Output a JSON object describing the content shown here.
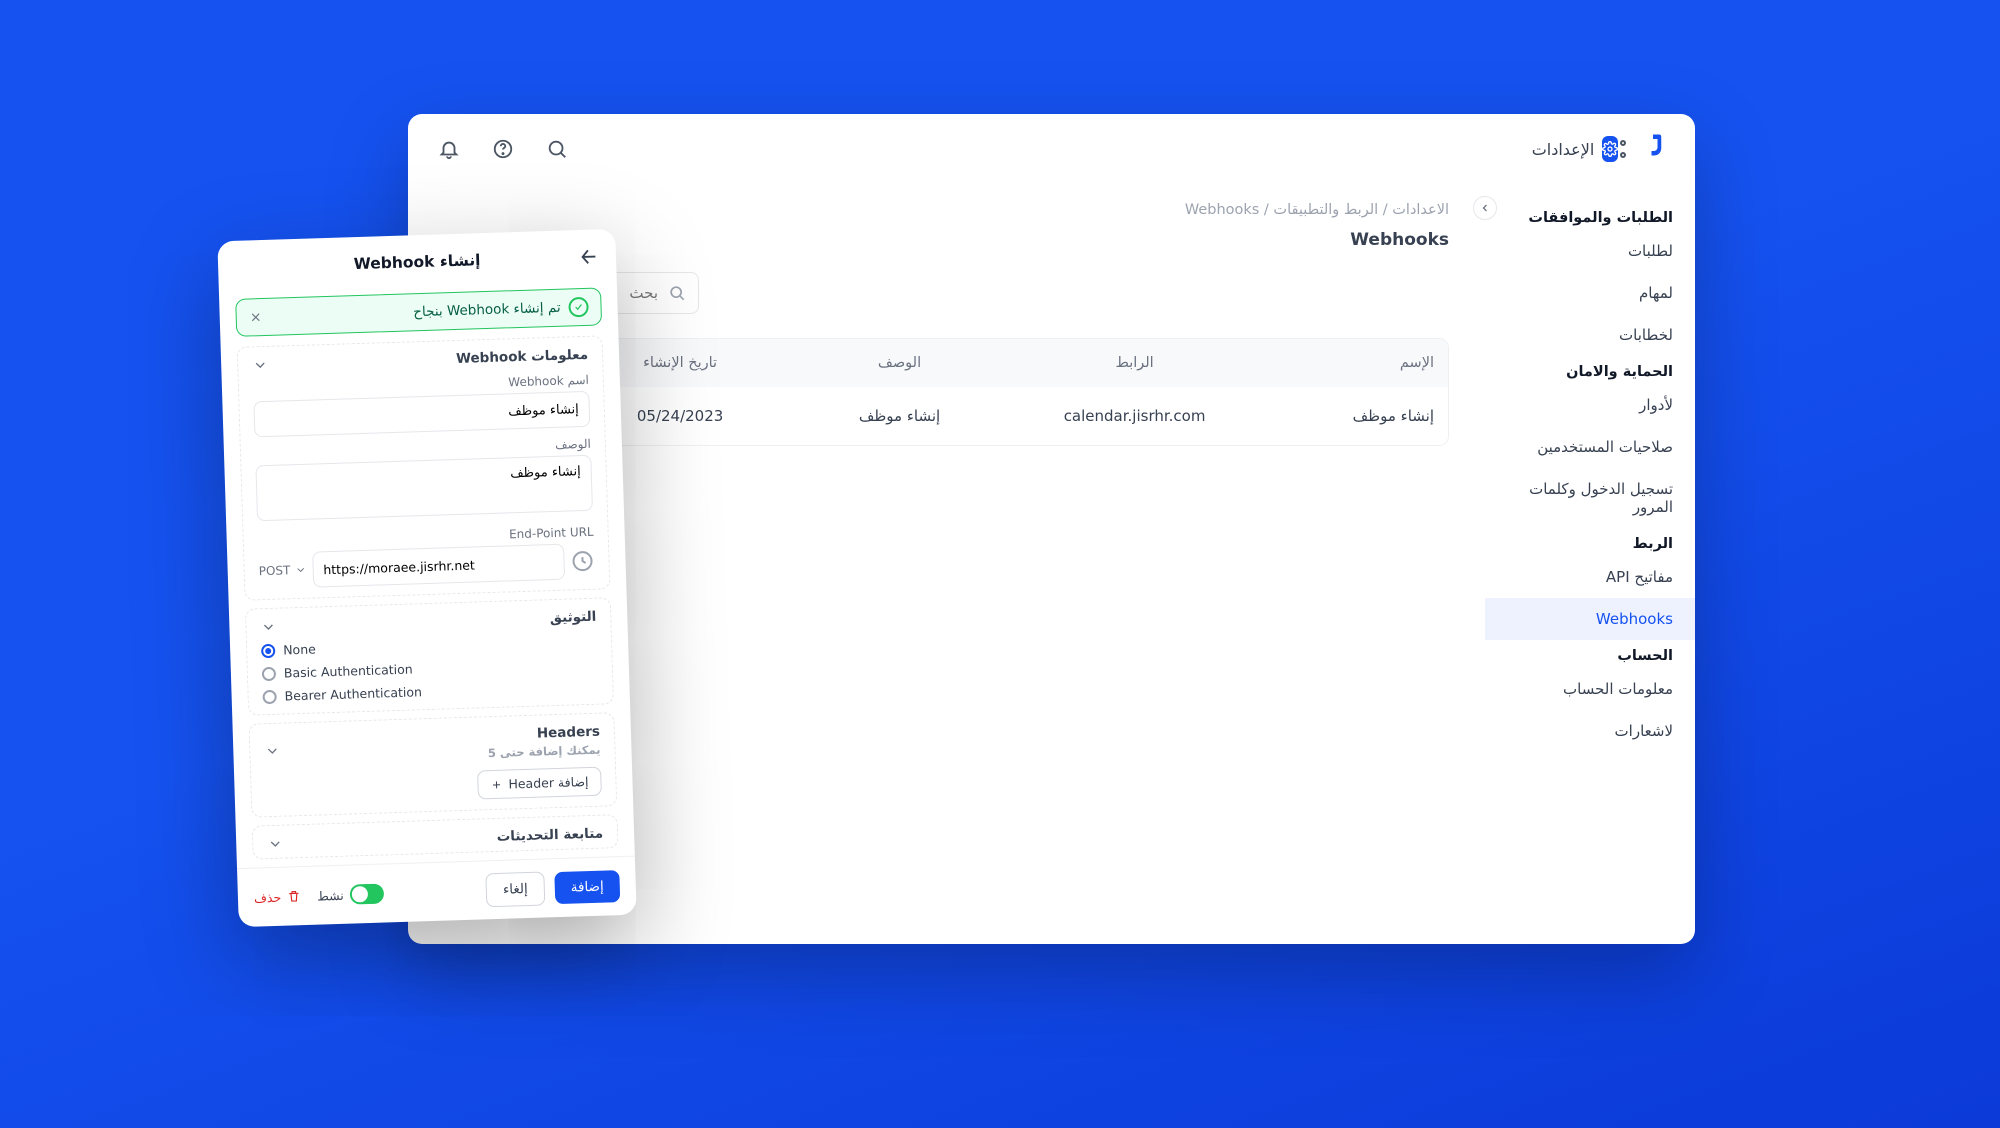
{
  "topbar": {
    "settings_label": "الإعدادات"
  },
  "sidebar": {
    "sections": [
      {
        "title": "الطلبات والموافقات",
        "items": [
          {
            "label": "لطلبات"
          },
          {
            "label": "لمهام"
          },
          {
            "label": "لخطابات"
          }
        ]
      },
      {
        "title": "الحماية والامان",
        "items": [
          {
            "label": "لأدوار"
          },
          {
            "label": "صلاحيات المستخدمين"
          },
          {
            "label": "تسجيل الدخول وكلمات المرور"
          }
        ]
      },
      {
        "title": "الربط",
        "items": [
          {
            "label": "مفاتيح API"
          },
          {
            "label": "Webhooks",
            "active": true
          }
        ]
      },
      {
        "title": "الحساب",
        "items": [
          {
            "label": "معلومات الحساب"
          },
          {
            "label": "لاشعارات"
          }
        ]
      }
    ]
  },
  "breadcrumbs": "الاعدادات / الربط والتطبيقات / Webhooks",
  "page_title": "Webhooks",
  "search": {
    "placeholder": "بحث"
  },
  "table": {
    "headers": {
      "name": "الإسم",
      "url": "الرابط",
      "desc": "الوصف",
      "date": "تاريخ الإنشاء",
      "actions": ""
    },
    "row": {
      "name": "إنشاء موظف",
      "url": "calendar.jisrhr.com",
      "desc": "إنشاء موظف",
      "date": "05/24/2023"
    }
  },
  "sheet": {
    "title": "إنشاء Webhook",
    "toast": "تم إنشاء  Webhook بنجاح",
    "sections": {
      "info_title": "معلومات Webhook",
      "auth_title": "التوثيق",
      "headers_title": "Headers",
      "headers_sub": "يمكنك إضافة حتى 5",
      "follow_title": "متابعة التحديثات"
    },
    "labels": {
      "name": "اسم Webhook",
      "desc": "الوصف",
      "endpoint": "End-Point URL"
    },
    "values": {
      "name": "إنشاء موظف",
      "desc": "إنشاء موظف",
      "method": "POST",
      "url": "https://moraee.jisrhr.net"
    },
    "auth": {
      "none": "None",
      "basic": "Basic Authentication",
      "bearer": "Bearer Authentication"
    },
    "buttons": {
      "add_header": "إضافة Header",
      "add": "إضافة",
      "cancel": "إلغاء",
      "active": "نشط",
      "delete": "حذف"
    }
  }
}
